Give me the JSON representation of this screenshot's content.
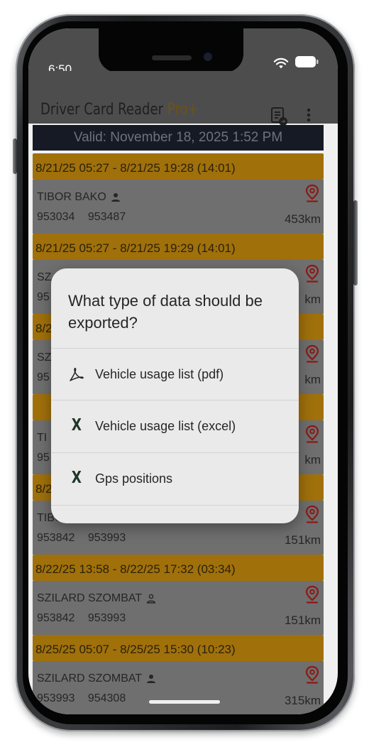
{
  "status_bar": {
    "time": "6:50"
  },
  "toolbar": {
    "title": "Driver Card Reader ",
    "title_pro": "Pro+"
  },
  "banner": {
    "valid": "Valid: November 18, 2025 1:52 PM"
  },
  "trips": [
    {
      "header": "8/21/25 05:27 - 8/21/25 19:28 (14:01)",
      "driver": "TIBOR BAKO",
      "driver_icon": "person-filled",
      "cards": "953034 953487",
      "km": "453km"
    },
    {
      "header": "8/21/25 05:27 - 8/21/25 19:29 (14:01)",
      "driver": "SZ",
      "driver_icon": "person-outline",
      "cards": "95",
      "km": "km"
    },
    {
      "header": "8/2",
      "driver": "SZ",
      "driver_icon": "person-outline",
      "cards": "95",
      "km": "km"
    },
    {
      "header": "",
      "driver": "TI",
      "driver_icon": "person-filled",
      "cards": "95",
      "km": "km"
    },
    {
      "header": "8/2",
      "driver": "TIBO",
      "driver_icon": "person-filled",
      "cards": "953842 953993",
      "km": "151km"
    },
    {
      "header": "8/22/25 13:58 - 8/22/25 17:32 (03:34)",
      "driver": "SZILARD SZOMBAT",
      "driver_icon": "person-outline",
      "cards": "953842 953993",
      "km": "151km"
    },
    {
      "header": "8/25/25 05:07 - 8/25/25 15:30 (10:23)",
      "driver": "SZILARD SZOMBAT",
      "driver_icon": "person-filled",
      "cards": "953993 954308",
      "km": "315km"
    }
  ],
  "dialog": {
    "title": "What type of data should be exported?",
    "items": [
      {
        "label": "Vehicle usage list (pdf)",
        "icon": "pdf-icon"
      },
      {
        "label": "Vehicle usage list (excel)",
        "icon": "excel-icon",
        "glyph": "X"
      },
      {
        "label": "Gps positions",
        "icon": "excel-icon",
        "glyph": "X"
      }
    ]
  },
  "colors": {
    "trip_header": "#a0700b",
    "trip_body": "#6f6f6f",
    "banner": "#161a24",
    "pin": "#8b1a14",
    "dialog": "#eaeaea",
    "excel_icon": "#203629"
  }
}
